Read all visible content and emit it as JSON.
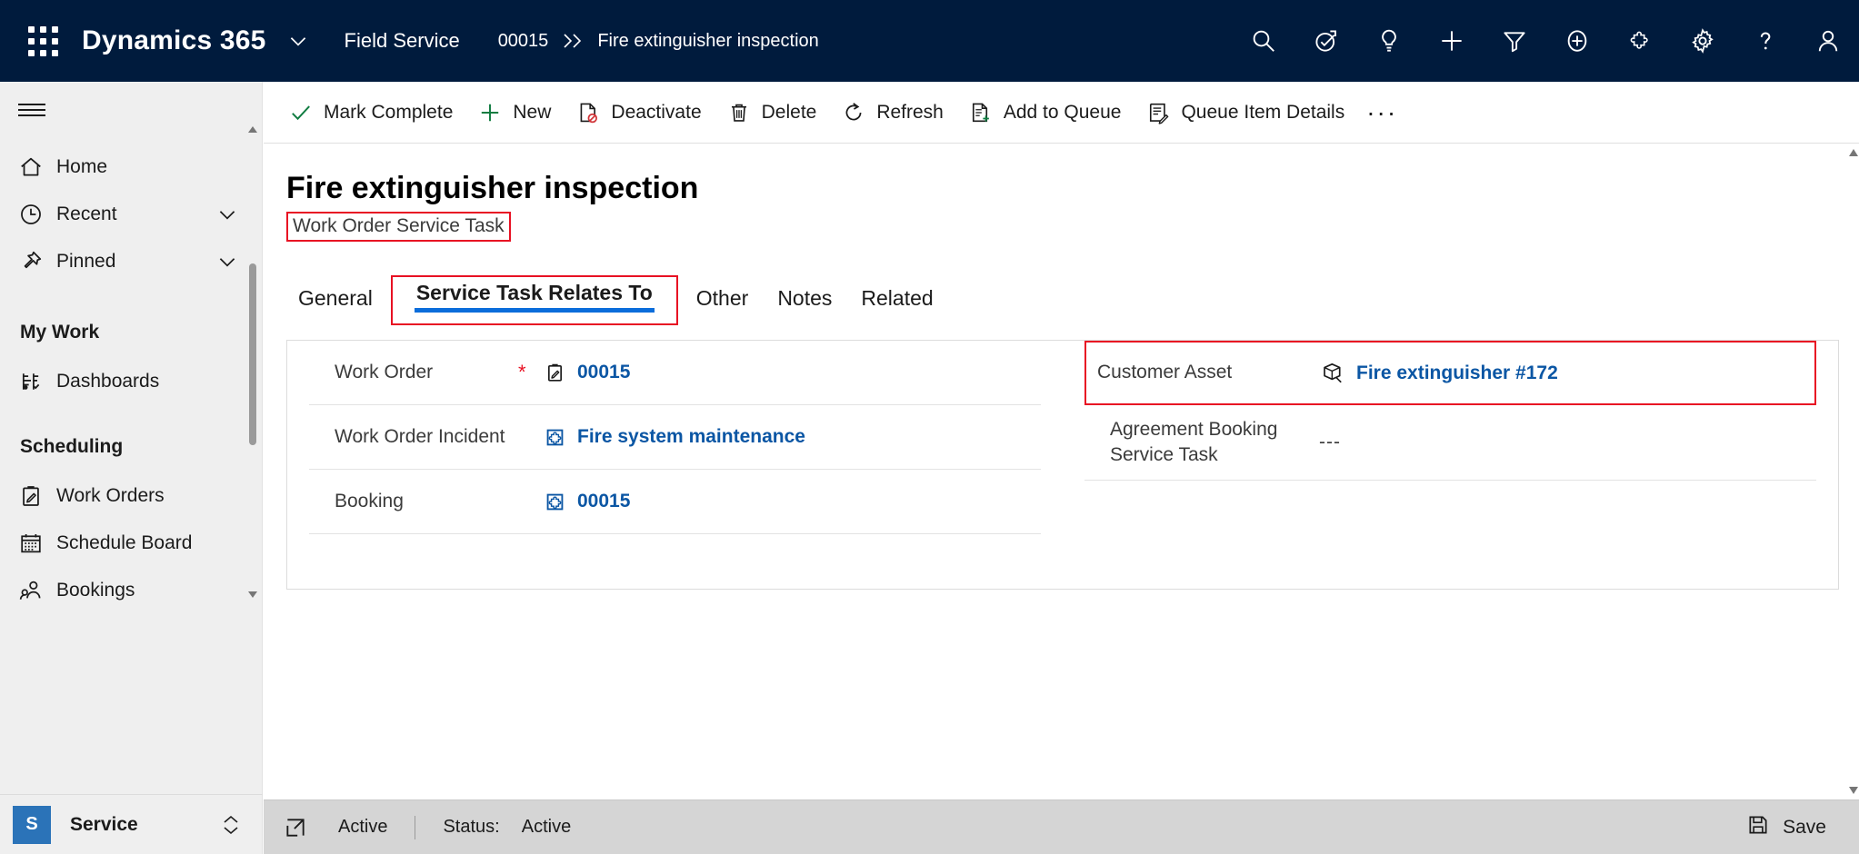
{
  "topnav": {
    "waffle_label": "app-launcher",
    "brand": "Dynamics 365",
    "app_name": "Field Service",
    "breadcrumb_parent": "00015",
    "breadcrumb_separator": "››",
    "breadcrumb_current": "Fire extinguisher inspection",
    "background": "#001b3d",
    "icons": [
      {
        "name": "search-icon",
        "label": "Search"
      },
      {
        "name": "assistant-icon",
        "label": "Assistant"
      },
      {
        "name": "lightbulb-icon",
        "label": "Insights"
      },
      {
        "name": "plus-icon",
        "label": "Quick create"
      },
      {
        "name": "filter-icon",
        "label": "Filter"
      },
      {
        "name": "add-circle-icon",
        "label": "Add"
      },
      {
        "name": "puzzle-icon",
        "label": "Apps"
      },
      {
        "name": "gear-icon",
        "label": "Settings"
      },
      {
        "name": "help-icon",
        "label": "Help"
      },
      {
        "name": "person-icon",
        "label": "Account"
      }
    ]
  },
  "sidebar": {
    "hamburger_label": "Expand navigation",
    "items": [
      {
        "label": "Home",
        "icon": "home-icon",
        "chevron": false
      },
      {
        "label": "Recent",
        "icon": "clock-icon",
        "chevron": true
      },
      {
        "label": "Pinned",
        "icon": "pin-icon",
        "chevron": true
      }
    ],
    "groups": [
      {
        "title": "My Work",
        "items": [
          {
            "label": "Dashboards",
            "icon": "dashboard-icon"
          }
        ]
      },
      {
        "title": "Scheduling",
        "items": [
          {
            "label": "Work Orders",
            "icon": "clipboard-pencil-icon"
          },
          {
            "label": "Schedule Board",
            "icon": "calendar-icon"
          },
          {
            "label": "Bookings",
            "icon": "people-icon"
          }
        ]
      }
    ],
    "footer": {
      "badge": "S",
      "label": "Service",
      "badge_color": "#2b73b8"
    }
  },
  "commandbar": {
    "commands": [
      {
        "label": "Mark Complete",
        "icon": "checkmark-icon"
      },
      {
        "label": "New",
        "icon": "plus-icon"
      },
      {
        "label": "Deactivate",
        "icon": "deactivate-icon"
      },
      {
        "label": "Delete",
        "icon": "trash-icon"
      },
      {
        "label": "Refresh",
        "icon": "refresh-icon"
      },
      {
        "label": "Add to Queue",
        "icon": "add-to-queue-icon"
      },
      {
        "label": "Queue Item Details",
        "icon": "queue-details-icon"
      }
    ],
    "overflow_label": "···"
  },
  "record": {
    "title": "Fire extinguisher inspection",
    "entity_name": "Work Order Service Task",
    "entity_highlight_color": "#e81123"
  },
  "tabs": {
    "items": [
      {
        "label": "General",
        "selected": false,
        "highlighted": false
      },
      {
        "label": "Service Task Relates To",
        "selected": true,
        "highlighted": true
      },
      {
        "label": "Other",
        "selected": false,
        "highlighted": false
      },
      {
        "label": "Notes",
        "selected": false,
        "highlighted": false
      },
      {
        "label": "Related",
        "selected": false,
        "highlighted": false
      }
    ],
    "underline_color": "#0b6ddb"
  },
  "form": {
    "left_fields": [
      {
        "label": "Work Order",
        "required": true,
        "icon": "clipboard-pencil-icon",
        "value": "00015",
        "is_link": true
      },
      {
        "label": "Work Order Incident",
        "required": false,
        "icon": "incident-icon",
        "value": "Fire system maintenance",
        "is_link": true
      },
      {
        "label": "Booking",
        "required": false,
        "icon": "incident-icon",
        "value": "00015",
        "is_link": true
      }
    ],
    "right_fields": [
      {
        "label": "Customer Asset",
        "required": false,
        "icon": "asset-box-icon",
        "value": "Fire extinguisher #172",
        "is_link": true,
        "highlighted": true
      },
      {
        "label": "Agreement Booking Service Task",
        "required": false,
        "icon": null,
        "value": "---",
        "is_link": false,
        "highlighted": false
      }
    ],
    "link_color": "#0b56a4"
  },
  "statusbar": {
    "expand_icon": "open-in-new-icon",
    "state": "Active",
    "status_label": "Status:",
    "status_value": "Active",
    "save_label": "Save",
    "save_icon": "save-icon"
  }
}
